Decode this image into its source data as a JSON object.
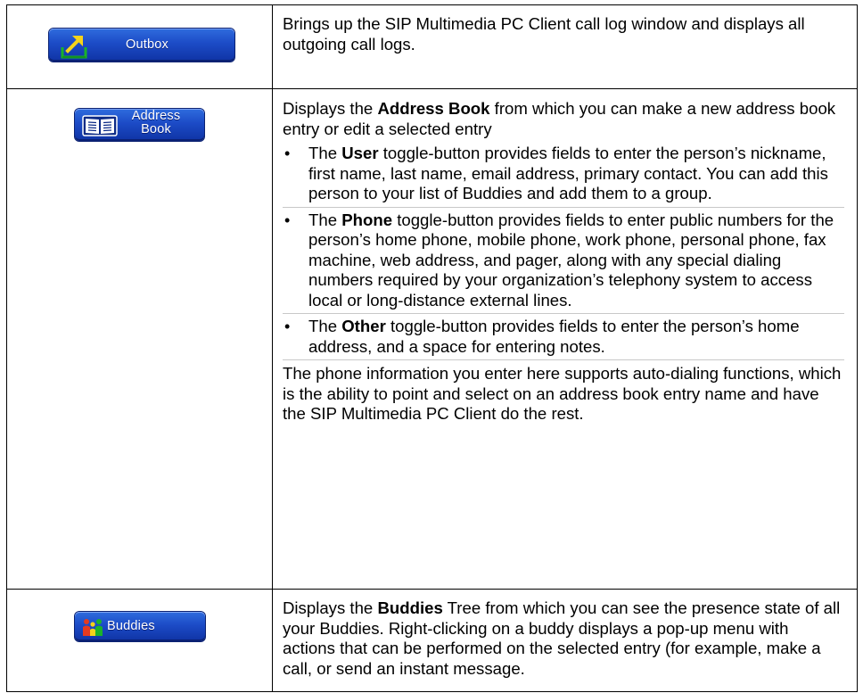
{
  "rows": [
    {
      "button": {
        "label": "Outbox",
        "icon": "outbox-icon"
      },
      "description": "Brings up the SIP Multimedia PC Client call log window and displays all outgoing call logs."
    },
    {
      "button": {
        "label_line1": "Address",
        "label_line2": "Book",
        "icon": "address-book-icon"
      },
      "intro_before": "Displays the ",
      "intro_bold": "Address Book",
      "intro_after": " from which you can make a new address book entry or edit a selected entry",
      "bullets": [
        {
          "before": "The ",
          "bold": "User",
          "after": " toggle-button provides fields to enter the person’s nickname, first name, last name, email address, primary contact. You can add this person to your list of Buddies and add them to a group."
        },
        {
          "before": "The ",
          "bold": "Phone",
          "after": " toggle-button provides fields to enter public numbers for the person’s home phone, mobile phone, work phone, personal phone, fax machine, web address, and pager, along with any special dialing numbers required by your organization’s telephony system to access local or long-distance external lines."
        },
        {
          "before": "The ",
          "bold": "Other",
          "after": " toggle-button provides fields to enter the person’s home address, and a space for entering notes."
        }
      ],
      "bullet_glyph": "•",
      "closing": "The phone information you enter here supports auto-dialing functions, which is the ability to point and select on an address book entry name and have the SIP Multimedia PC Client do the rest."
    },
    {
      "button": {
        "label": "Buddies",
        "icon": "buddies-icon"
      },
      "intro_before": "Displays the ",
      "intro_bold": "Buddies",
      "intro_after": " Tree from which you can see the presence state of all your Buddies. Right-clicking on a buddy displays a pop-up menu with actions that can be performed on the selected entry (for example, make a call, or send an instant message."
    }
  ],
  "colors": {
    "button_top": "#2f6cde",
    "button_bottom": "#0f33a4",
    "outbox_icon_yellow": "#f5d31a",
    "outbox_icon_green": "#1ab32a"
  }
}
